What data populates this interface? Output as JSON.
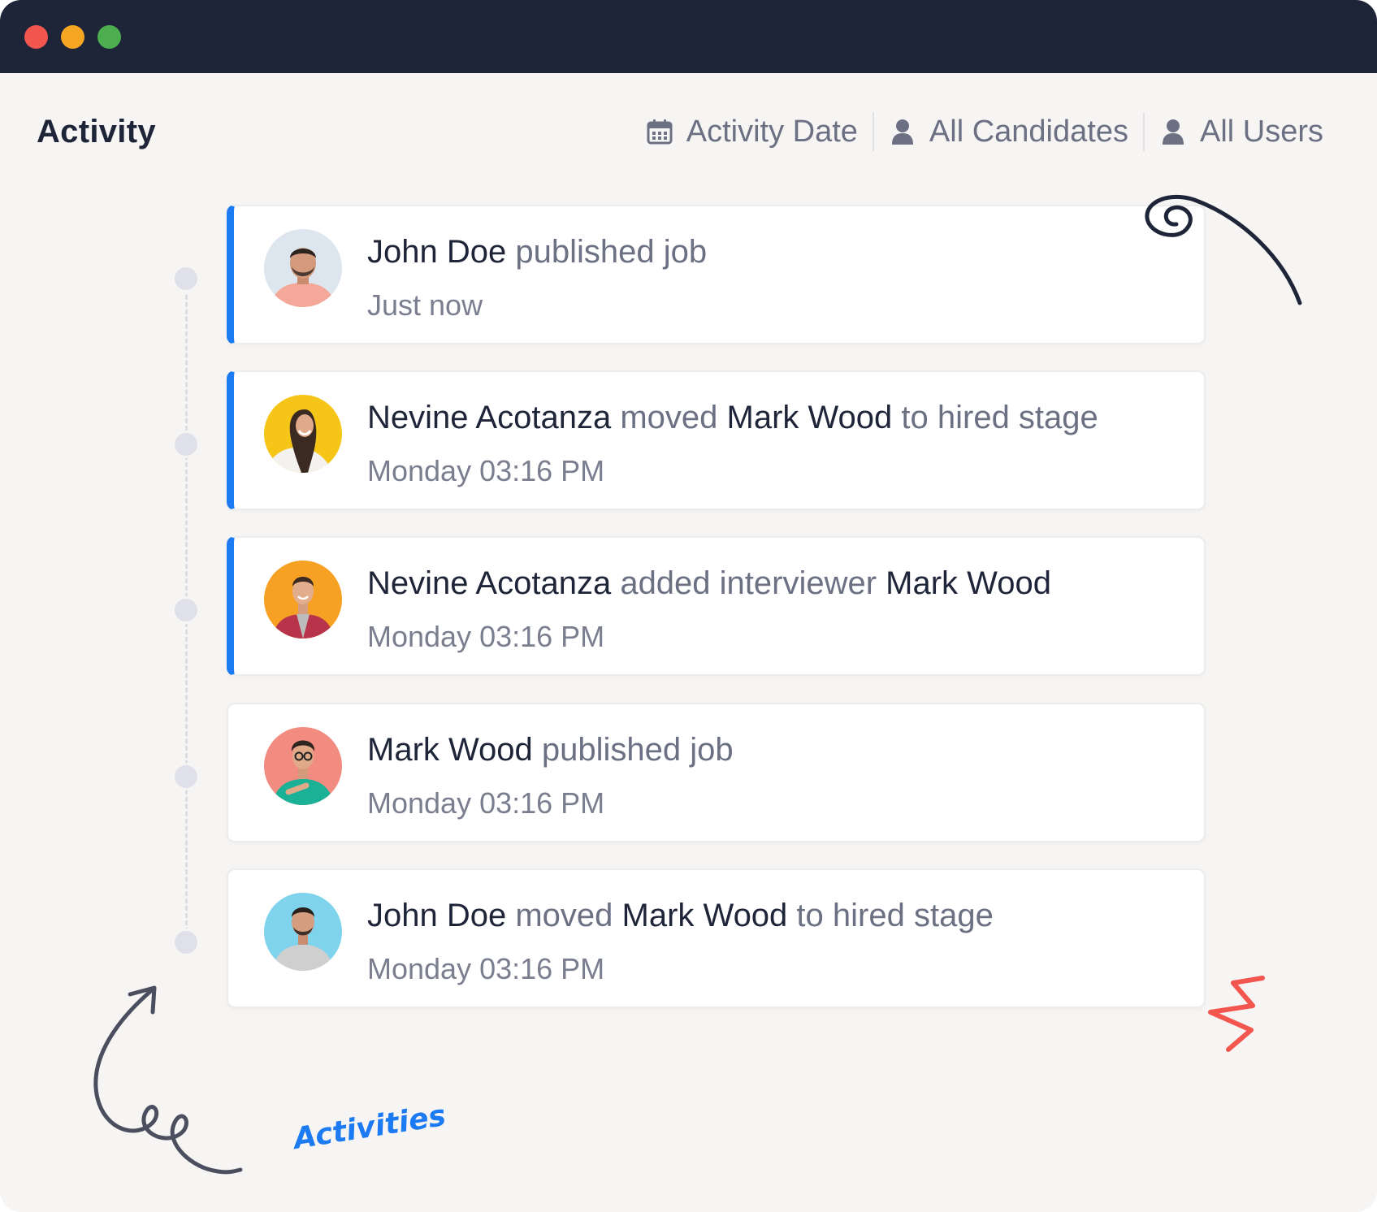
{
  "window": {
    "title_bar_color": "#1f2539",
    "controls": [
      "close",
      "minimize",
      "maximize"
    ]
  },
  "header": {
    "title": "Activity",
    "filters": [
      {
        "label": "Activity Date",
        "icon": "calendar-icon"
      },
      {
        "label": "All Candidates",
        "icon": "user-icon"
      },
      {
        "label": "All Users",
        "icon": "user-icon"
      }
    ]
  },
  "activities": [
    {
      "actor": "John Doe",
      "segments": [
        " published job"
      ],
      "time": "Just now",
      "highlighted": true
    },
    {
      "actor": "Nevine Acotanza",
      "action": " moved ",
      "target": "Mark Wood",
      "rest": " to hired stage",
      "time": "Monday 03:16 PM",
      "highlighted": true
    },
    {
      "actor": "Nevine Acotanza",
      "action": " added interviewer ",
      "target": "Mark Wood",
      "time": "Monday 03:16 PM",
      "highlighted": true
    },
    {
      "actor": "Mark Wood",
      "segments": [
        " published job"
      ],
      "time": "Monday 03:16 PM",
      "highlighted": false
    },
    {
      "actor": "John Doe",
      "action": " moved ",
      "target": "Mark Wood",
      "rest": " to hired stage",
      "time": "Monday 03:16 PM",
      "highlighted": false
    }
  ],
  "annotation": {
    "label": "Activities",
    "accent_color": "#1c7af2"
  }
}
